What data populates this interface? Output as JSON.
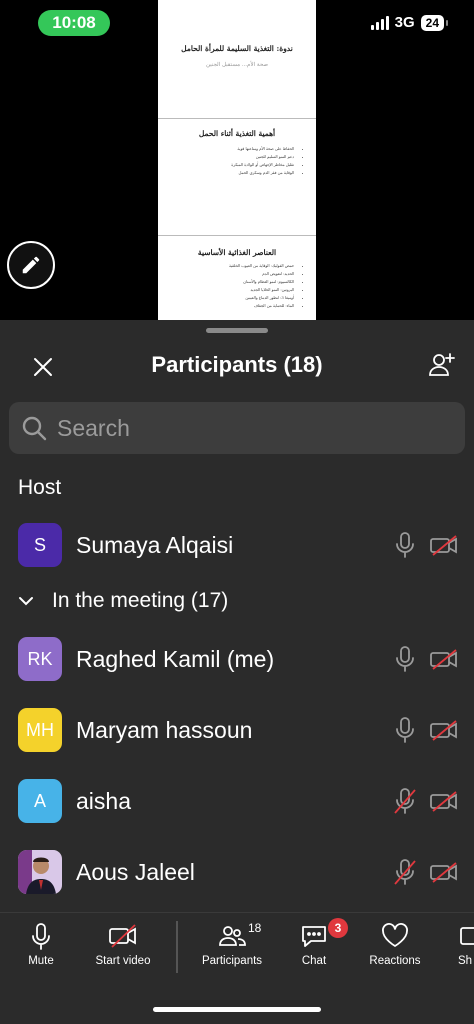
{
  "status": {
    "time": "10:08",
    "network": "3G",
    "battery": "24"
  },
  "document": {
    "slides": [
      {
        "title": "ندوة: التغذية السليمة للمرأة الحامل",
        "subtitle": "صحة الأم... مستقبل الجنين",
        "bullets": []
      },
      {
        "title": "أهمية التغذية أثناء الحمل",
        "subtitle": "",
        "bullets": [
          "الحفاظ على صحة الأم ومناعتها قوية",
          "دعم النمو السليم للجنين",
          "تقليل مخاطر الإجهاض أو الولادة المبكرة",
          "الوقاية من فقر الدم وسكري الحمل"
        ]
      },
      {
        "title": "العناصر الغذائية الأساسية",
        "subtitle": "",
        "bullets": [
          "حمض الفوليك: الوقاية من العيوب الخلقية",
          "الحديد: لتعويض الدم",
          "الكالسيوم: لنمو العظام والأسنان",
          "البروتين: النمو الخلايا الجديد",
          "أوميغا 3: لتطور الدماغ والعينين",
          "الماء: للحماية من الجفاف"
        ]
      }
    ]
  },
  "panel": {
    "title": "Participants (18)",
    "search_placeholder": "Search",
    "host_label": "Host",
    "meeting_label": "In the meeting (17)",
    "host": {
      "name": "Sumaya Alqaisi",
      "initials": "S",
      "color": "#4b2aa8",
      "mic_muted": false,
      "video_off": true
    },
    "participants": [
      {
        "name": "Raghed Kamil (me)",
        "initials": "RK",
        "color": "#8e6cc9",
        "mic_muted": false,
        "video_off": true
      },
      {
        "name": "Maryam hassoun",
        "initials": "MH",
        "color": "#f4d22b",
        "mic_muted": false,
        "video_off": true
      },
      {
        "name": "aisha",
        "initials": "A",
        "color": "#47b3e8",
        "mic_muted": true,
        "video_off": true
      },
      {
        "name": "Aous Jaleel",
        "initials": "",
        "color": "#6a6a6a",
        "mic_muted": true,
        "video_off": true,
        "photo": true
      }
    ]
  },
  "toolbar": {
    "mute": "Mute",
    "start_video": "Start video",
    "participants": "Participants",
    "participants_count": "18",
    "chat": "Chat",
    "chat_badge": "3",
    "reactions": "Reactions",
    "share": "Sh"
  },
  "colors": {
    "sheet_bg": "#2b2b2b",
    "search_bg": "#3d3d3d",
    "muted_red": "#e0383e",
    "status_green": "#34c759"
  }
}
